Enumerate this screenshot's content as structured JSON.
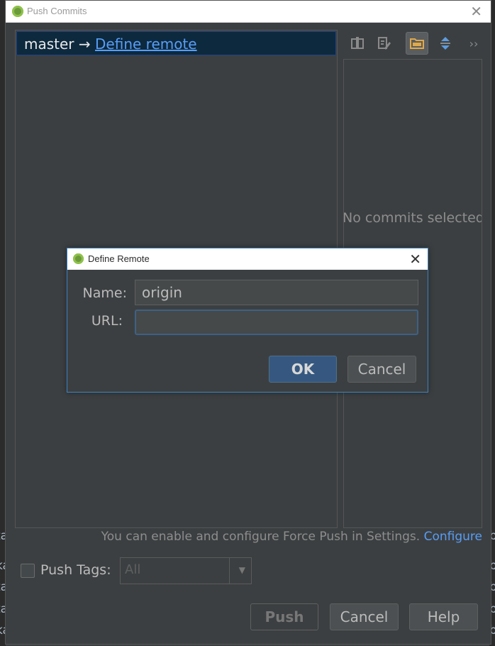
{
  "window": {
    "title": "Push Commits"
  },
  "branch": {
    "name": "master",
    "arrow": "→",
    "remote_link": "Define remote"
  },
  "details": {
    "empty_text": "No commits selected"
  },
  "force_push": {
    "text": "You can enable and configure Force Push in Settings.",
    "link": "Configure"
  },
  "push_tags": {
    "label": "Push Tags:",
    "checked": false,
    "selected": "All"
  },
  "buttons": {
    "push": "Push",
    "cancel": "Cancel",
    "help": "Help"
  },
  "dialog": {
    "title": "Define Remote",
    "name_label": "Name:",
    "name_value": "origin",
    "url_label": "URL:",
    "url_value": "",
    "ok": "OK",
    "cancel": "Cancel"
  },
  "colors": {
    "background": "#3c3f41",
    "link": "#589df6",
    "selection": "#0d293e",
    "primary_button": "#365880"
  }
}
